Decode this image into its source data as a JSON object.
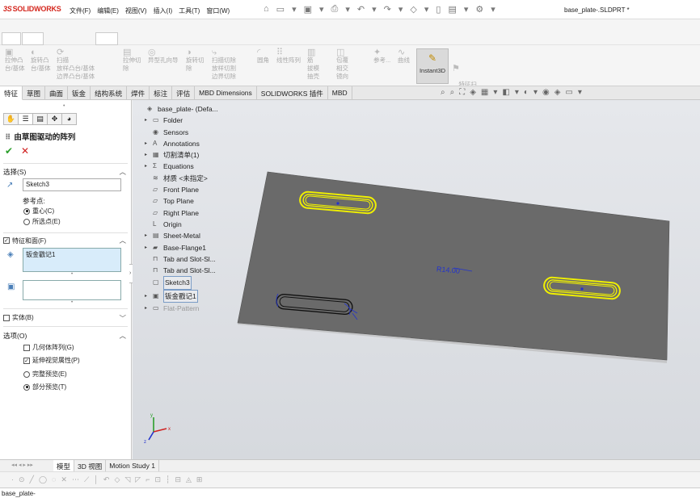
{
  "app": {
    "logo_mark": "3S",
    "logo_text": "SOLIDWORKS",
    "doc_title": "base_plate-.SLDPRT *"
  },
  "menu": [
    "文件(F)",
    "编辑(E)",
    "视图(V)",
    "插入(I)",
    "工具(T)",
    "窗口(W)"
  ],
  "title_tools": [
    "⌂",
    "▭",
    "▾",
    "▣",
    "▾",
    "⎙",
    "▾",
    "↶",
    "▾",
    "↷",
    "▾",
    "◇",
    "▾",
    "▯",
    "▤",
    "▾",
    "⚙",
    "▾"
  ],
  "commands": [
    {
      "label": "拉伸凸\n台/基体",
      "icon": "▣"
    },
    {
      "label": "旋转凸\n台/基体",
      "icon": "◐"
    },
    {
      "label": "扫描\n放样凸台/基体\n边界凸台/基体",
      "icon": "⟳"
    },
    {
      "label": "拉伸切\n除",
      "icon": "▤"
    },
    {
      "label": "异型孔向导",
      "icon": "◎"
    },
    {
      "label": "旋转切\n除",
      "icon": "◑"
    },
    {
      "label": "扫描切除\n放样切割\n边界切除",
      "icon": "⤷"
    },
    {
      "label": "圆角",
      "icon": "◜"
    },
    {
      "label": "线性阵列",
      "icon": "⠿"
    },
    {
      "label": "筋\n拔模\n抽壳",
      "icon": "▥"
    },
    {
      "label": "包覆\n相交\n镜向",
      "icon": "◫"
    },
    {
      "label": "参考...",
      "icon": "✦"
    },
    {
      "label": "曲线",
      "icon": "∿"
    }
  ],
  "instant3d": {
    "label": "Instant3D",
    "icon": "✎"
  },
  "feature_scan": {
    "label": "特征扫\n描",
    "icon": "⚑"
  },
  "tabs": [
    "特征",
    "草图",
    "曲面",
    "钣金",
    "结构系统",
    "焊件",
    "标注",
    "评估",
    "MBD Dimensions",
    "SOLIDWORKS 插件",
    "MBD"
  ],
  "view_tools": [
    "⌕",
    "⌕",
    "⛶",
    "◈",
    "▦",
    "▾",
    "◧",
    "▾",
    "◐",
    "▾",
    "◉",
    "◈",
    "▭",
    "▾"
  ],
  "pm": {
    "tab_icons": [
      "✋",
      "☰",
      "▤",
      "✥",
      "◕"
    ],
    "title": "由草图驱动的阵列",
    "title_icon": "⠿",
    "ok": "✔",
    "cancel": "✕",
    "selection": {
      "header": "选择(S)",
      "sketch_value": "Sketch3",
      "ref_label": "参考点:",
      "ref_options": [
        {
          "label": "重心(C)",
          "selected": true
        },
        {
          "label": "所选点(E)",
          "selected": false
        }
      ]
    },
    "features": {
      "header": "特征和面(F)",
      "item": "钣金戳记1"
    },
    "bodies": {
      "header": "实体(B)"
    },
    "options": {
      "header": "选项(O)",
      "checks": [
        {
          "label": "几何体阵列(G)",
          "checked": false
        },
        {
          "label": "延伸视觉属性(P)",
          "checked": true
        }
      ],
      "previews": [
        {
          "label": "完整预览(E)",
          "selected": false
        },
        {
          "label": "部分预览(T)",
          "selected": true
        }
      ]
    },
    "chev": "︿",
    "chev_down": "﹀"
  },
  "tree": [
    {
      "label": "base_plate- (Defa...",
      "icon": "◈",
      "arrow": "",
      "level": 0
    },
    {
      "label": "Folder",
      "icon": "▭",
      "arrow": "▸",
      "level": 1
    },
    {
      "label": "Sensors",
      "icon": "◉",
      "arrow": "",
      "level": 1
    },
    {
      "label": "Annotations",
      "icon": "A",
      "arrow": "▸",
      "level": 1
    },
    {
      "label": "切割清单(1)",
      "icon": "▦",
      "arrow": "▸",
      "level": 1
    },
    {
      "label": "Equations",
      "icon": "Σ",
      "arrow": "▸",
      "level": 1
    },
    {
      "label": "材质 <未指定>",
      "icon": "≋",
      "arrow": "",
      "level": 1
    },
    {
      "label": "Front Plane",
      "icon": "▱",
      "arrow": "",
      "level": 1
    },
    {
      "label": "Top Plane",
      "icon": "▱",
      "arrow": "",
      "level": 1
    },
    {
      "label": "Right Plane",
      "icon": "▱",
      "arrow": "",
      "level": 1
    },
    {
      "label": "Origin",
      "icon": "L",
      "arrow": "",
      "level": 1
    },
    {
      "label": "Sheet-Metal",
      "icon": "▤",
      "arrow": "▸",
      "level": 1
    },
    {
      "label": "Base-Flange1",
      "icon": "▰",
      "arrow": "▸",
      "level": 1
    },
    {
      "label": "Tab and Slot-Sl...",
      "icon": "⊓",
      "arrow": "",
      "level": 1
    },
    {
      "label": "Tab and Slot-Sl...",
      "icon": "⊓",
      "arrow": "",
      "level": 1
    },
    {
      "label": "Sketch3",
      "icon": "▢",
      "arrow": "",
      "level": 1,
      "boxed": true
    },
    {
      "label": "钣金戳记1",
      "icon": "▣",
      "arrow": "▸",
      "level": 1,
      "boxed": true
    },
    {
      "label": "Flat-Pattern",
      "icon": "▭",
      "arrow": "▸",
      "level": 1,
      "dim": true
    }
  ],
  "viewport": {
    "dimension_label": "R14.00",
    "plate_color": "#6a6a6a",
    "highlight_color": "#f0f000",
    "dim_color": "#2233cc"
  },
  "triad": {
    "x": "x",
    "y": "y",
    "z": "z"
  },
  "bottom_tabs": [
    "模型",
    "3D 视图",
    "Motion Study 1"
  ],
  "bottom_nav": "◂◂ ◂ ▸ ▸▸",
  "sketch_tools": [
    "·",
    "⊙",
    "╱",
    "◯",
    "◌",
    "✕",
    "⋯",
    "⟋",
    "│",
    "↶",
    "◇",
    "◹",
    "◸",
    "⌐",
    "⊡",
    "┆",
    "⊟",
    "◬",
    "⊞"
  ],
  "status": "base_plate-"
}
